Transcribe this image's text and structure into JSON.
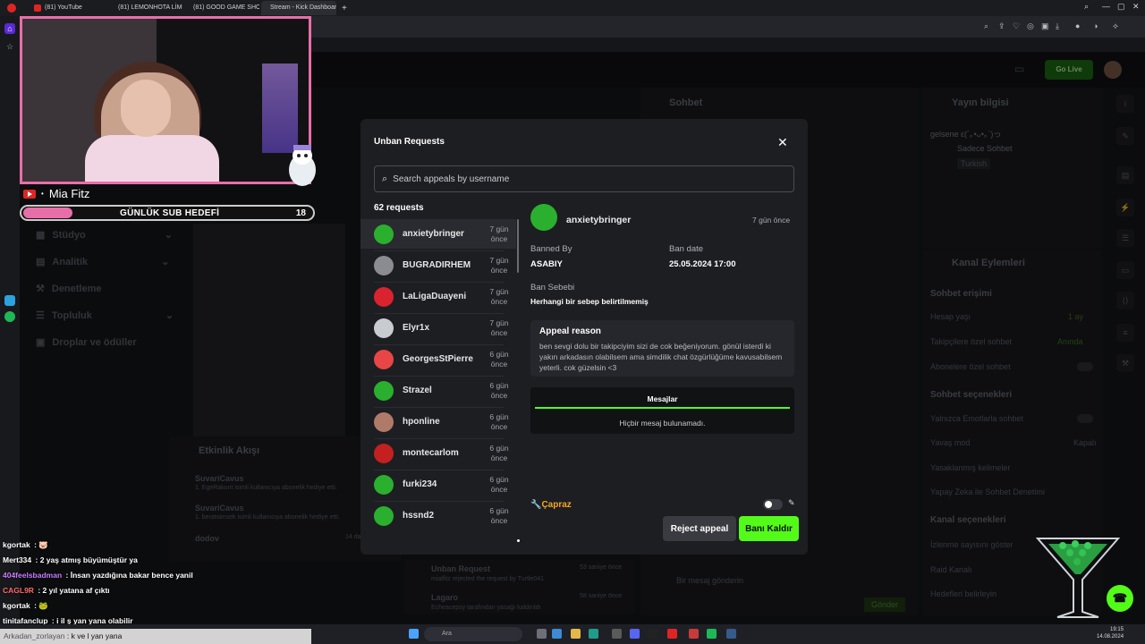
{
  "browser": {
    "tabs": [
      {
        "label": "(81) YouTube"
      },
      {
        "label": "(81) LEMONHOTA LİMON"
      },
      {
        "label": "(81) GOOD GAME SHOW"
      },
      {
        "label": "Stream - Kick Dashboard"
      }
    ]
  },
  "overlay": {
    "streamer_name": "Mia Fitz",
    "sub_goal_label": "GÜNLÜK SUB HEDEFİ",
    "sub_goal_value": "18",
    "sub_goal_progress": 0.17
  },
  "dashboard": {
    "go_live": "Go Live",
    "nav": [
      "Stüdyo",
      "Analitik",
      "Denetleme",
      "Topluluk",
      "Droplar ve ödüller"
    ],
    "chat_title": "Sohbet",
    "stream_info_title": "Yayın bilgisi",
    "stream_info_text": "gelsene ε(´｡•ᴗ•｡`)っ",
    "stream_info_category": "Sadece Sohbet",
    "stream_info_lang": "Turkish",
    "activity_title": "Etkinlik Akışı",
    "activity": [
      {
        "user": "SuvariCavus",
        "text": "1. EgeRakunt isimli kullanıcıya abonelik hediye etti."
      },
      {
        "user": "SuvariCavus",
        "text": "1. beratsimsek isimli kullanıcıya abonelik hediye etti."
      },
      {
        "user": "dodov",
        "text": "Hyper",
        "time": "14 dakika önce"
      },
      {
        "user": "dodov",
        "text": "Hyper",
        "time": "14 dakika önce"
      }
    ],
    "unban_feed_title": "Unban Request",
    "unban_feed_text": "mialfitz rejected the request by Turtle041",
    "unban_feed_time": "53 saniye önce",
    "lagaro": "Lagaro",
    "lagaro_text": "Echeacepsy tarafından yasağı kaldırıldı",
    "lagaro_time": "58 saniye önce",
    "chat_placeholder": "Bir mesaj gönderin",
    "send": "Gönder",
    "channel_actions_title": "Kanal Eylemleri",
    "channel_access": "Sohbet erişimi",
    "rows_access": [
      {
        "label": "Hesap yaşı",
        "value": "1 ay"
      },
      {
        "label": "Takipçilere özel sohbet",
        "value": "Anında"
      },
      {
        "label": "Abonelere özel sohbet",
        "value": ""
      }
    ],
    "chat_options": "Sohbet seçenekleri",
    "rows_options": [
      {
        "label": "Yalnızca Emotlarla sohbet",
        "value": ""
      },
      {
        "label": "Yavaş mod",
        "value": "Kapalı"
      },
      {
        "label": "Yasaklanmış kelimeler",
        "value": ""
      },
      {
        "label": "Yapay Zeka ile Sohbet Denetimi",
        "value": ""
      }
    ],
    "channel_options": "Kanal seçenekleri",
    "rows_channel": [
      "İzlenme sayısını göster",
      "Raid Kanalı",
      "Hedefleri belirleyin"
    ]
  },
  "chat_overlay": [
    {
      "name": "kgortak",
      "text": "🐷",
      "color": "#ffffff"
    },
    {
      "name": "Mert334",
      "text": "2 yaş atmış büyümüştür ya",
      "color": "#ffffff"
    },
    {
      "name": "404feelsbadman",
      "text": "İnsan yazdığına bakar bence yanil",
      "color": "#c97cff"
    },
    {
      "name": "CAGL9R",
      "text": "2 yıl yatana af çıktı",
      "color": "#ff6a6a"
    },
    {
      "name": "kgortak",
      "text": "🐸",
      "color": "#ffffff"
    },
    {
      "name": "tinitafanclup",
      "text": "i il ş yan yana olabilir",
      "color": "#ffffff"
    }
  ],
  "ticker": {
    "user": "Arkadan_zorlayan",
    "text": "k ve l yan yana"
  },
  "modal": {
    "title": "Unban Requests",
    "search_placeholder": "Search appeals by username",
    "count_label": "62 requests",
    "requests": [
      {
        "user": "anxietybringer",
        "time": "7 gün önce",
        "color": "#2ab02e"
      },
      {
        "user": "BUGRADIRHEM",
        "time": "7 gün önce",
        "color": "#8a8c92"
      },
      {
        "user": "LaLigaDuayeni",
        "time": "7 gün önce",
        "color": "#d9232e"
      },
      {
        "user": "Elyr1x",
        "time": "7 gün önce",
        "color": "#c8cbd0"
      },
      {
        "user": "GeorgesStPierre",
        "time": "6 gün önce",
        "color": "#e84646"
      },
      {
        "user": "Strazel",
        "time": "6 gün önce",
        "color": "#2ab02e"
      },
      {
        "user": "hponline",
        "time": "6 gün önce",
        "color": "#b07a6a"
      },
      {
        "user": "montecarlom",
        "time": "6 gün önce",
        "color": "#c42020"
      },
      {
        "user": "furki234",
        "time": "6 gün önce",
        "color": "#2ab02e"
      },
      {
        "user": "hssnd2",
        "time": "6 gün önce",
        "color": "#2ab02e"
      }
    ],
    "detail": {
      "user": "anxietybringer",
      "time": "7 gün önce",
      "banned_by_label": "Banned By",
      "banned_by": "ASABIY",
      "ban_date_label": "Ban date",
      "ban_date": "25.05.2024 17:00",
      "reason_label": "Ban Sebebi",
      "reason": "Herhangi bir sebep belirtilmemiş",
      "appeal_title": "Appeal reason",
      "appeal_text": "ben sevgi dolu bir takipciyim sizi de cok beğeniyorum. gönül isterdi ki yakın arkadasın olabilsem ama simdilik chat özgürlüğüme kavusabilsem yeterli. cok güzelsin <3",
      "messages_tab": "Mesajlar",
      "messages_empty": "Hiçbir mesaj bulunamadı.",
      "capraz": "Çapraz",
      "reject": "Reject appeal",
      "unban": "Banı Kaldır"
    }
  },
  "taskbar": {
    "search": "Ara",
    "time": "19:15",
    "date": "14.08.2024"
  },
  "colors": {
    "accent": "#53fc18",
    "cam_border": "#e86ea8",
    "capraz": "#f5a623"
  }
}
